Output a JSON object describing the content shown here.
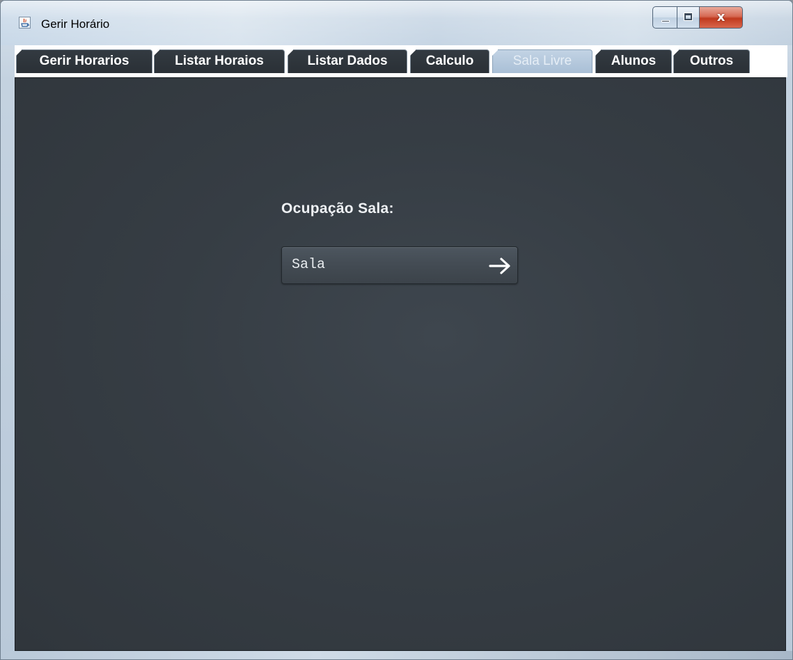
{
  "window": {
    "title": "Gerir Horário",
    "app_icon": "java-icon",
    "controls": {
      "minimize": "minimize-icon",
      "maximize": "maximize-icon",
      "close": "x"
    }
  },
  "tabs": [
    {
      "label": "Gerir Horarios",
      "active": false
    },
    {
      "label": "Listar Horaios",
      "active": false
    },
    {
      "label": "Listar Dados",
      "active": false
    },
    {
      "label": "Calculo",
      "active": false
    },
    {
      "label": "Sala Livre",
      "active": true
    },
    {
      "label": "Alunos",
      "active": false
    },
    {
      "label": "Outros",
      "active": false
    }
  ],
  "main": {
    "section_label": "Ocupação Sala:",
    "room_field": {
      "value": "Sala",
      "icon": "arrow-right-icon"
    }
  },
  "colors": {
    "panel_background": "#363d44",
    "tab_background": "#2e343a",
    "active_tab_background": "#b3c6da",
    "text": "#ffffff"
  }
}
